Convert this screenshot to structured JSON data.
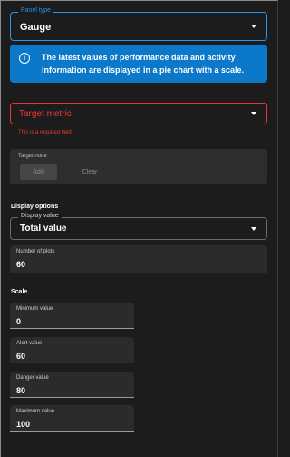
{
  "panel_type": {
    "label": "Panel type",
    "value": "Gauge"
  },
  "info": {
    "icon": "info-icon",
    "text": "The latest values of performance data and activity information are displayed in a pie chart with a scale."
  },
  "target_metric": {
    "placeholder": "Target metric",
    "error": "This is a required field."
  },
  "target_node": {
    "label": "Target node",
    "add_label": "Add",
    "clear_label": "Clear"
  },
  "display_options": {
    "heading": "Display options",
    "display_value_label": "Display value",
    "display_value": "Total value",
    "num_plots_label": "Number of plots",
    "num_plots": "60"
  },
  "scale": {
    "heading": "Scale",
    "min_label": "Minimum value",
    "min_value": "0",
    "alert_label": "Alert value",
    "alert_value": "60",
    "danger_label": "Danger value",
    "danger_value": "80",
    "max_label": "Maximum value",
    "max_value": "100"
  },
  "colors": {
    "accent": "#2196f3",
    "info_bg": "#0b78c9",
    "error": "#e53935",
    "background": "#1c1c1c"
  }
}
